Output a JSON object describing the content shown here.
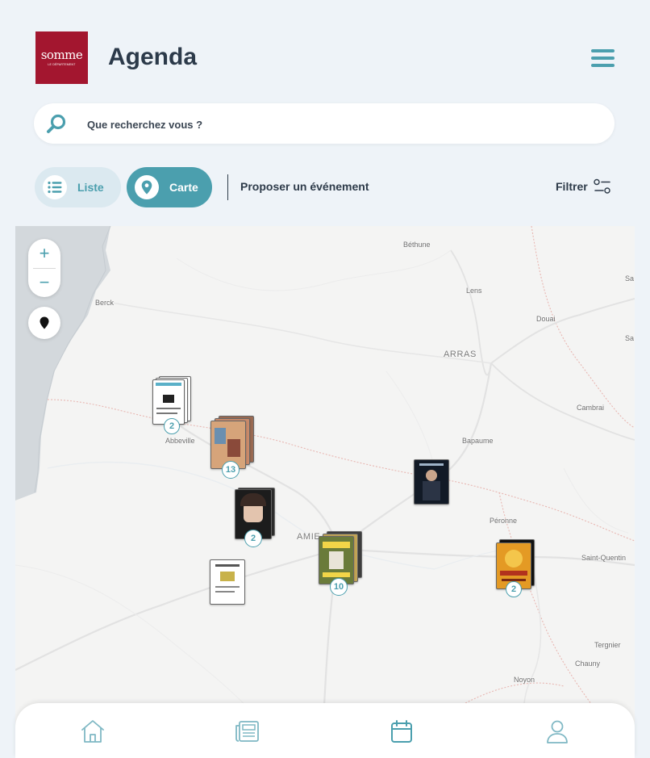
{
  "header": {
    "logo_text": "somme",
    "logo_subtext": "LE DÉPARTEMENT",
    "title": "Agenda",
    "menu_icon": "hamburger-icon"
  },
  "search": {
    "placeholder": "Que recherchez vous ?",
    "value": "",
    "icon": "search-icon"
  },
  "view_toggle": {
    "list_label": "Liste",
    "map_label": "Carte",
    "active": "Carte"
  },
  "actions": {
    "propose_label": "Proposer un événement",
    "filter_label": "Filtrer"
  },
  "colors": {
    "accent": "#4b9fae",
    "brand": "#a3162f",
    "background": "#eef3f8",
    "text": "#2e3b4a"
  },
  "map": {
    "zoom_in": "+",
    "zoom_out": "−",
    "places": [
      {
        "name": "Béthune"
      },
      {
        "name": "Sa"
      },
      {
        "name": "Berck"
      },
      {
        "name": "Lens"
      },
      {
        "name": "Douai"
      },
      {
        "name": "Sa"
      },
      {
        "name": "ARRAS"
      },
      {
        "name": "Cambrai"
      },
      {
        "name": "Abbeville"
      },
      {
        "name": "Bapaume"
      },
      {
        "name": "Péronne"
      },
      {
        "name": "AMIE"
      },
      {
        "name": "Saint-Quentin"
      },
      {
        "name": "Tergnier"
      },
      {
        "name": "Chauny"
      },
      {
        "name": "Noyon"
      }
    ],
    "clusters": [
      {
        "count": "2"
      },
      {
        "count": "13"
      },
      {
        "count": "2"
      },
      {
        "count": "10"
      },
      {
        "count": "2"
      }
    ]
  },
  "bottom_nav": [
    {
      "icon": "home-icon"
    },
    {
      "icon": "news-icon"
    },
    {
      "icon": "calendar-icon",
      "active": true
    },
    {
      "icon": "user-icon"
    }
  ]
}
